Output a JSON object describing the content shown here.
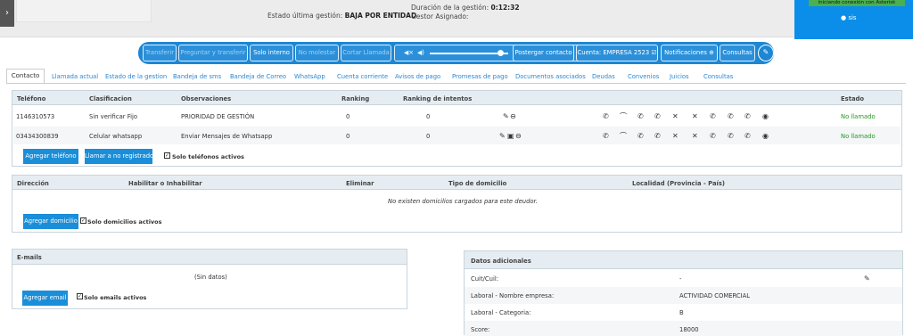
{
  "header": {
    "estado_label": "Estado última gestión:",
    "estado_value": "BAJA POR ENTIDAD",
    "duracion_label": "Duración de la gestión:",
    "duracion_value": "0:12:32",
    "gestor_label": "Gestor Asignado:",
    "status": "iniciando conexión con Asterisk",
    "user": "sis"
  },
  "toolbar": {
    "transferir": "Transferir",
    "preguntar": "Preguntar y transferir",
    "solo_interno": "Solo interno",
    "no_molestar": "No molestar",
    "cortar": "Cortar Llamada",
    "postergar": "Postergar contacto",
    "cuenta": "Cuenta: EMPRESA 2523",
    "notificaciones": "Notificaciones",
    "consultas": "Consultas",
    "volume": 0.9
  },
  "tabs": [
    "Contacto",
    "Llamada actual",
    "Estado de la gestion",
    "Bandeja de sms",
    "Bandeja de Correo",
    "WhatsApp",
    "Cuenta corriente",
    "Avisos de pago",
    "Promesas de pago",
    "Documentos asociados",
    "Deudas",
    "Convenios",
    "Juicios",
    "Consultas"
  ],
  "phones": {
    "headers": {
      "telefono": "Teléfono",
      "clasificacion": "Clasificacion",
      "observaciones": "Observaciones",
      "ranking": "Ranking",
      "ranking_intentos": "Ranking de intentos",
      "estado": "Estado"
    },
    "rows": [
      {
        "telefono": "1146310573",
        "clasificacion": "Sin verificar Fijo",
        "observaciones": "PRIORIDAD DE GESTIÓN",
        "ranking": "0",
        "intentos": "0",
        "estado": "No llamado"
      },
      {
        "telefono": "03434300839",
        "clasificacion": "Celular whatsapp",
        "observaciones": "Enviar Mensajes de Whatsapp",
        "ranking": "0",
        "intentos": "0",
        "estado": "No llamado"
      }
    ],
    "add_btn": "Agregar teléfono",
    "call_btn": "Llamar a no registrado",
    "only_active": "Solo teléfonos activos"
  },
  "addresses": {
    "headers": {
      "direccion": "Dirección",
      "habilitar": "Habilitar o Inhabilitar",
      "eliminar": "Eliminar",
      "tipo": "Tipo de domicilio",
      "localidad": "Localidad (Provincia - País)"
    },
    "empty": "No existen domicilios cargados para este deudor.",
    "add_btn": "Agregar domicilio",
    "only_active": "Solo domicilios activos"
  },
  "emails": {
    "title": "E-mails",
    "empty": "(Sin datos)",
    "add_btn": "Agregar email",
    "only_active": "Solo emails activos"
  },
  "extra": {
    "title": "Datos adicionales",
    "rows": [
      {
        "label": "Cuit/Cuil:",
        "value": "-"
      },
      {
        "label": "Laboral - Nombre empresa:",
        "value": "ACTIVIDAD COMERCIAL"
      },
      {
        "label": "Laboral - Categoria:",
        "value": "B"
      },
      {
        "label": "Score:",
        "value": "18000"
      }
    ]
  }
}
